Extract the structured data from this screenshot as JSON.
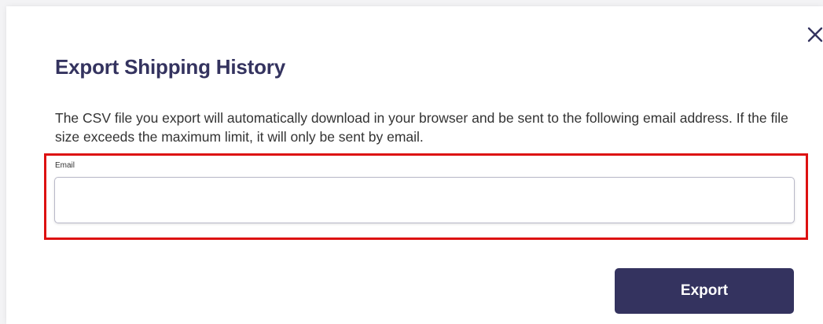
{
  "dialog": {
    "title": "Export Shipping History",
    "description": "The CSV file you export will automatically download in your browser and be sent to the following email address. If the file size exceeds the maximum limit, it will only be sent by email.",
    "email_label": "Email",
    "email_value": "",
    "export_label": "Export",
    "close_icon": "close-icon"
  },
  "colors": {
    "title": "#34335f",
    "primary_button": "#34335f",
    "highlight_border": "#dd1111"
  }
}
